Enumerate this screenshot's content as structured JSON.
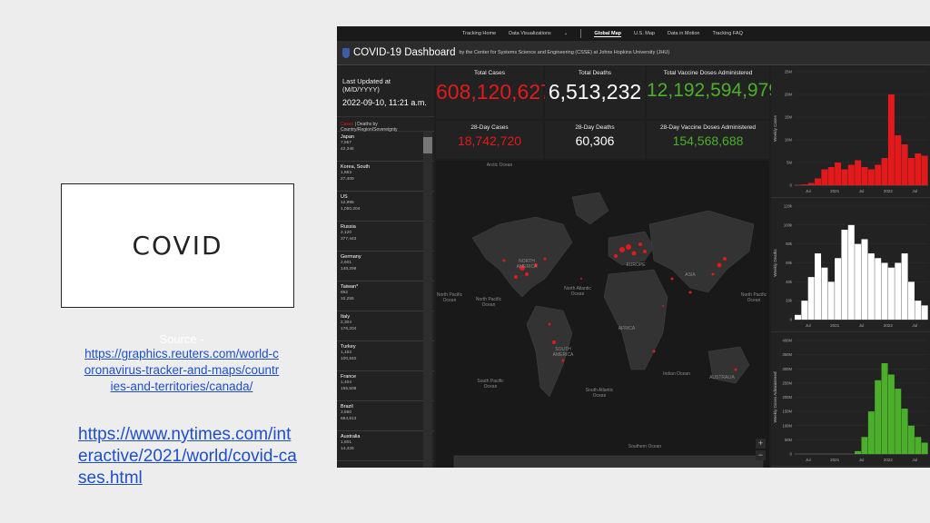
{
  "slide": {
    "title": "COVID",
    "source_label": "Source -",
    "source_link_1": "https://graphics.reuters.com/world-coronavirus-tracker-and-maps/countries-and-territories/canada/",
    "source_link_2": "https://www.nytimes.com/interactive/2021/world/covid-cases.html"
  },
  "dashboard": {
    "nav": [
      "Tracking Home",
      "Data Visualizations",
      "Global Map",
      "U.S. Map",
      "Data in Motion",
      "Tracking FAQ"
    ],
    "nav_active": "Global Map",
    "title": "COVID-19 Dashboard",
    "subtitle": "by the Center for Systems Science and Engineering (CSSE) at Johns Hopkins University (JHU)",
    "last_updated_label": "Last Updated at (M/D/YYYY)",
    "last_updated_value": "2022-09-10, 11:21 a.m.",
    "list_header_red": "Cases",
    "list_header_rest": " | Deaths by Country/Region/Sovereignty",
    "stats": {
      "total_cases_label": "Total Cases",
      "total_cases": "608,120,627",
      "total_deaths_label": "Total Deaths",
      "total_deaths": "6,513,232",
      "total_vaccine_label": "Total Vaccine Doses Administered",
      "total_vaccine": "12,192,594,979",
      "cases_28_label": "28-Day Cases",
      "cases_28": "18,742,720",
      "deaths_28_label": "28-Day Deaths",
      "deaths_28": "60,306",
      "vaccine_28_label": "28-Day Vaccine Doses Administered",
      "vaccine_28": "154,568,688"
    },
    "countries": [
      {
        "name": "Japan",
        "day28_deaths": "7,557",
        "total_deaths": "42,346"
      },
      {
        "name": "Korea, South",
        "day28_deaths": "1,863",
        "total_deaths": "27,409"
      },
      {
        "name": "US",
        "day28_deaths": "12,995",
        "total_deaths": "1,050,204"
      },
      {
        "name": "Russia",
        "day28_deaths": "2,120",
        "total_deaths": "377,443"
      },
      {
        "name": "Germany",
        "day28_deaths": "2,601",
        "total_deaths": "148,299"
      },
      {
        "name": "Taiwan*",
        "day28_deaths": "852",
        "total_deaths": "10,255"
      },
      {
        "name": "Italy",
        "day28_deaths": "2,304",
        "total_deaths": "176,204"
      },
      {
        "name": "Turkey",
        "day28_deaths": "1,162",
        "total_deaths": "100,840"
      },
      {
        "name": "France",
        "day28_deaths": "1,404",
        "total_deaths": "155,508"
      },
      {
        "name": "Brazil",
        "day28_deaths": "3,560",
        "total_deaths": "684,813"
      },
      {
        "name": "Australia",
        "day28_deaths": "1,601",
        "total_deaths": "14,426"
      }
    ],
    "map_labels": {
      "arctic": "Arctic Ocean",
      "north_america": "NORTH AMERICA",
      "north_atlantic": "North Atlantic Ocean",
      "north_pacific_left": "North Pacific Ocean",
      "north_pacific_mid": "North Pacific Ocean",
      "north_pacific_right": "North Pacific Ocean",
      "europe": "EUROPE",
      "asia": "ASIA",
      "africa": "AFRICA",
      "south_america": "SOUTH AMERICA",
      "south_pacific": "South Pacific Ocean",
      "south_atlantic": "South Atlantic Ocean",
      "indian": "Indian Ocean",
      "australia": "AUSTRALIA",
      "southern": "Southern Ocean"
    },
    "zoom_in": "+",
    "zoom_out": "−"
  },
  "charts": {
    "x_ticks": [
      "Jul",
      "2021",
      "Jul",
      "2022",
      "Jul"
    ],
    "cases_y_label": "Weekly Cases",
    "deaths_y_label": "Weekly Deaths",
    "vaccine_y_label": "Weekly Doses Administered",
    "cases_y_ticks": [
      "25M",
      "20M",
      "15M",
      "10M",
      "5M",
      "0"
    ],
    "deaths_y_ticks": [
      "120k",
      "100k",
      "80k",
      "60k",
      "40k",
      "20k",
      "0"
    ],
    "vaccine_y_ticks": [
      "400M",
      "350M",
      "300M",
      "250M",
      "200M",
      "150M",
      "100M",
      "50M",
      "0"
    ],
    "colors": {
      "cases": "#e31a1c",
      "deaths": "#ffffff",
      "vaccine": "#4caf2b"
    }
  },
  "chart_data": [
    {
      "type": "area",
      "title": "",
      "ylabel": "Weekly Cases",
      "ylim": [
        0,
        25000000
      ],
      "x": [
        "Jul",
        "2021",
        "Jul",
        "2022",
        "Jul"
      ],
      "values": [
        100000,
        200000,
        500000,
        1500000,
        3500000,
        4000000,
        5000000,
        3500000,
        4500000,
        5500000,
        4000000,
        3500000,
        4500000,
        6000000,
        20000000,
        11000000,
        9000000,
        6000000,
        7000000,
        6500000
      ]
    },
    {
      "type": "area",
      "title": "",
      "ylabel": "Weekly Deaths",
      "ylim": [
        0,
        120000
      ],
      "x": [
        "Jul",
        "2021",
        "Jul",
        "2022",
        "Jul"
      ],
      "values": [
        5000,
        20000,
        45000,
        70000,
        55000,
        40000,
        65000,
        95000,
        100000,
        80000,
        85000,
        70000,
        65000,
        60000,
        55000,
        60000,
        70000,
        40000,
        20000,
        15000
      ]
    },
    {
      "type": "area",
      "title": "",
      "ylabel": "Weekly Doses Administered",
      "ylim": [
        0,
        400000000
      ],
      "x": [
        "Jul",
        "2021",
        "Jul",
        "2022",
        "Jul"
      ],
      "values": [
        0,
        0,
        0,
        0,
        0,
        0,
        0,
        0,
        0,
        10000000,
        60000000,
        150000000,
        260000000,
        320000000,
        280000000,
        230000000,
        160000000,
        100000000,
        60000000,
        40000000
      ]
    }
  ]
}
